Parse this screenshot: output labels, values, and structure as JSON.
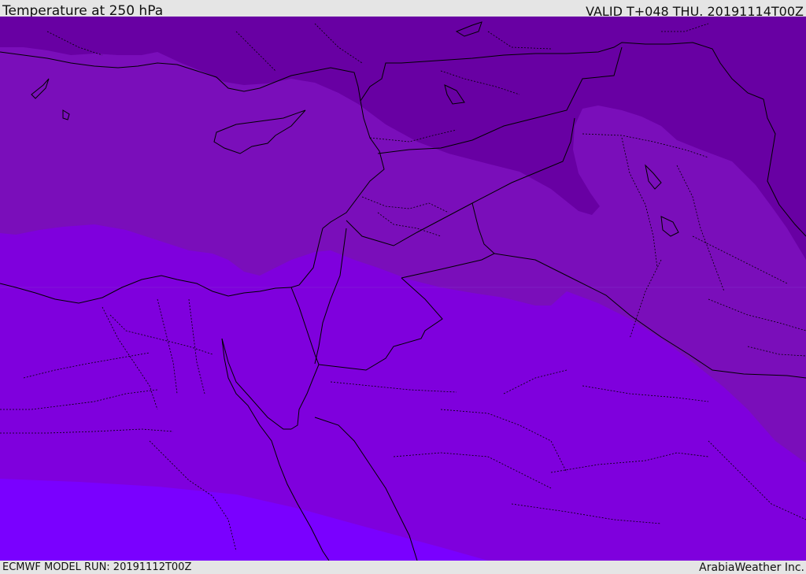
{
  "header": {
    "title": "Temperature at 250 hPa",
    "valid": "VALID T+048 THU. 20191114T00Z"
  },
  "footer": {
    "model_run": "ECMWF MODEL RUN: 20191112T00Z",
    "credit": "ArabiaWeather Inc."
  },
  "map": {
    "field_colors": {
      "band_1": "#6800a3",
      "band_2": "#7a0eba",
      "band_3": "#7f00dd",
      "band_4": "#7a00ff"
    },
    "border_color": "#000000"
  }
}
